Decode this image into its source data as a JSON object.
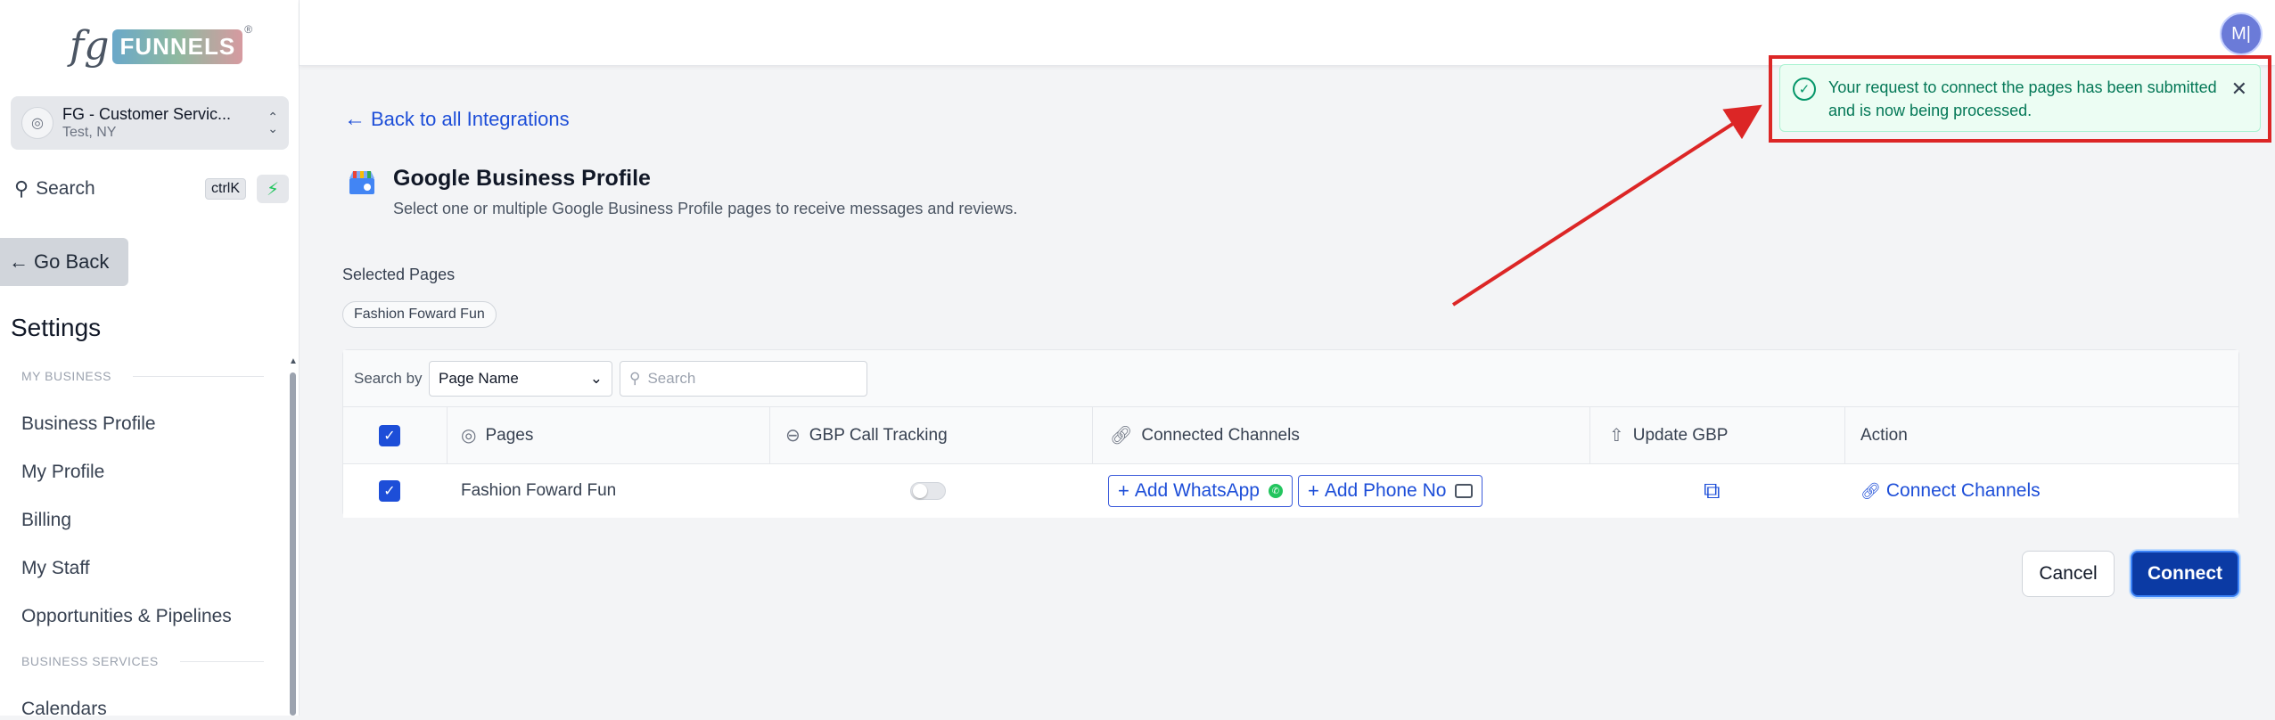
{
  "brand": {
    "logo_prefix": "fg",
    "logo_word": "FUNNELS",
    "logo_reg": "®"
  },
  "account": {
    "name": "FG - Customer Servic...",
    "location": "Test, NY"
  },
  "sidebar_search": {
    "label": "Search",
    "shortcut": "ctrlK"
  },
  "go_back_label": "Go Back",
  "settings_title": "Settings",
  "sections": {
    "my_business": "MY BUSINESS",
    "business_services": "BUSINESS SERVICES"
  },
  "nav": {
    "business_profile": "Business Profile",
    "my_profile": "My Profile",
    "billing": "Billing",
    "my_staff": "My Staff",
    "opportunities": "Opportunities & Pipelines",
    "calendars": "Calendars"
  },
  "user_initials": "M|",
  "back_link": "Back to all Integrations",
  "integration": {
    "title": "Google Business Profile",
    "description": "Select one or multiple Google Business Profile pages to receive messages and reviews."
  },
  "selected": {
    "label": "Selected Pages",
    "chips": [
      "Fashion Foward Fun"
    ]
  },
  "filter": {
    "search_by": "Search by",
    "select_value": "Page Name",
    "search_placeholder": "Search"
  },
  "columns": {
    "pages": "Pages",
    "gbp_call_tracking": "GBP Call Tracking",
    "connected_channels": "Connected Channels",
    "update_gbp": "Update GBP",
    "action": "Action"
  },
  "rows": [
    {
      "page": "Fashion Foward Fun",
      "call_tracking_on": false,
      "add_whatsapp": "Add WhatsApp",
      "add_phone": "Add Phone No",
      "action": "Connect Channels"
    }
  ],
  "buttons": {
    "cancel": "Cancel",
    "connect": "Connect"
  },
  "toast": {
    "message": "Your request to connect the pages has been submitted and is now being processed."
  },
  "colors": {
    "accent": "#1d4ed8",
    "primary_button": "#0b3aa4",
    "success_text": "#047857",
    "annotation": "#dc2626"
  }
}
